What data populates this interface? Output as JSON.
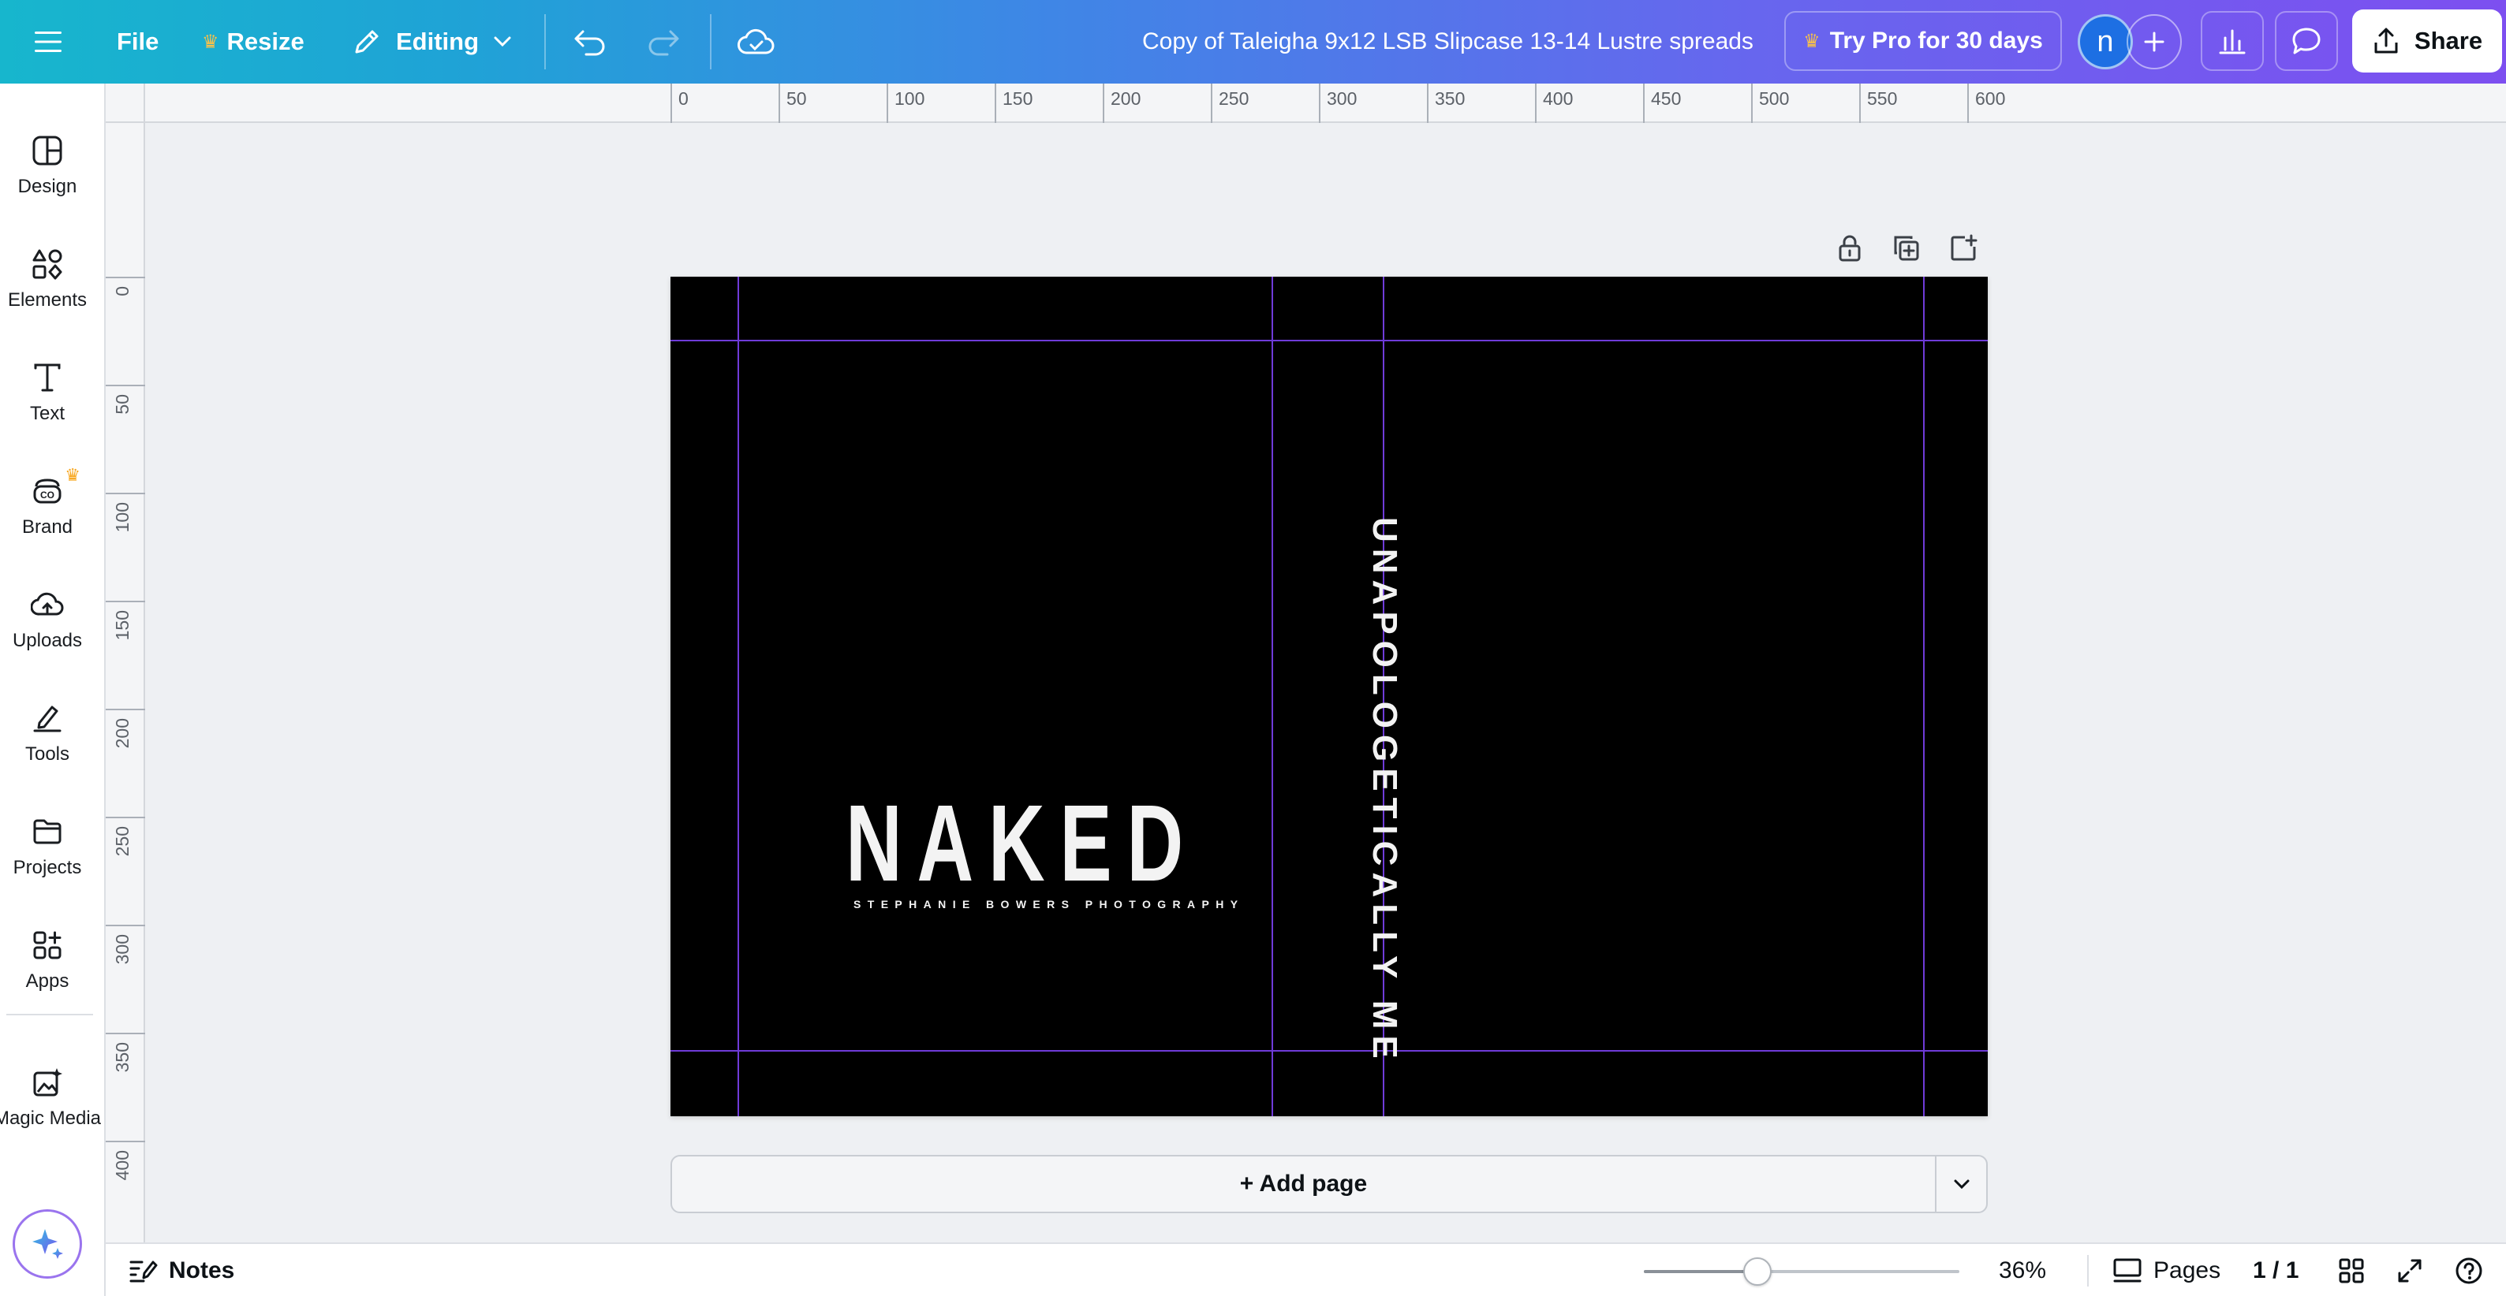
{
  "topbar": {
    "file": "File",
    "resize": "Resize",
    "editing": "Editing",
    "doc_title": "Copy of Taleigha 9x12 LSB Slipcase 13-14 Lustre spreads",
    "try_pro": "Try Pro for 30 days",
    "avatar_initial": "n",
    "share": "Share"
  },
  "sidebar": {
    "items": [
      {
        "label": "Design",
        "icon": "design-icon"
      },
      {
        "label": "Elements",
        "icon": "elements-icon"
      },
      {
        "label": "Text",
        "icon": "text-icon"
      },
      {
        "label": "Brand",
        "icon": "brand-icon"
      },
      {
        "label": "Uploads",
        "icon": "uploads-icon"
      },
      {
        "label": "Tools",
        "icon": "tools-icon"
      },
      {
        "label": "Projects",
        "icon": "projects-icon"
      },
      {
        "label": "Apps",
        "icon": "apps-icon"
      },
      {
        "label": "Magic Media",
        "icon": "magic-media-icon"
      }
    ]
  },
  "ruler": {
    "top": [
      "0",
      "50",
      "100",
      "150",
      "200",
      "250",
      "300",
      "350",
      "400",
      "450",
      "500",
      "550",
      "600"
    ],
    "left": [
      "0",
      "50",
      "100",
      "150",
      "200",
      "250",
      "300",
      "350",
      "400"
    ]
  },
  "canvas": {
    "cover_title": "NAKED",
    "cover_subtitle": "STEPHANIE BOWERS PHOTOGRAPHY",
    "spine_text": "UNAPOLOGETICALLY ME",
    "background_color": "#000000",
    "guide_color": "#6f3bd8",
    "add_page": "+ Add page"
  },
  "bottombar": {
    "notes": "Notes",
    "zoom": "36%",
    "zoom_level": 0.36,
    "pages": "Pages",
    "page_count": "1 / 1"
  },
  "colors": {
    "topbar_gradient_start": "#17b6cd",
    "topbar_gradient_end": "#7d4ff0",
    "crown": "#f7a51b",
    "avatar": "#1d6fe3"
  }
}
